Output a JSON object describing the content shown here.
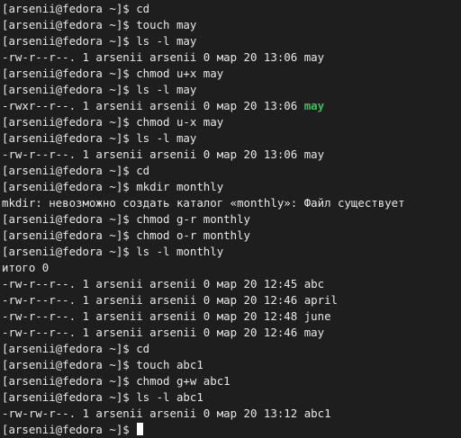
{
  "terminal": {
    "prompt": "[arsenii@fedora ~]$ ",
    "lines": [
      "[arsenii@fedora ~]$ cd",
      "[arsenii@fedora ~]$ touch may",
      "[arsenii@fedora ~]$ ls -l may",
      "-rw-r--r--. 1 arsenii arsenii 0 мар 20 13:06 may",
      "[arsenii@fedora ~]$ chmod u+x may",
      "[arsenii@fedora ~]$ ls -l may",
      "-rwxr--r--. 1 arsenii arsenii 0 мар 20 13:06 ",
      "[arsenii@fedora ~]$ chmod u-x may",
      "[arsenii@fedora ~]$ ls -l may",
      "-rw-r--r--. 1 arsenii arsenii 0 мар 20 13:06 may",
      "[arsenii@fedora ~]$ cd",
      "[arsenii@fedora ~]$ mkdir monthly",
      "mkdir: невозможно создать каталог «monthly»: Файл существует",
      "[arsenii@fedora ~]$ chmod g-r monthly",
      "[arsenii@fedora ~]$ chmod o-r monthly",
      "[arsenii@fedora ~]$ ls -l monthly",
      "итого 0",
      "-rw-r--r--. 1 arsenii arsenii 0 мар 20 12:45 abc",
      "-rw-r--r--. 1 arsenii arsenii 0 мар 20 12:46 april",
      "-rw-r--r--. 1 arsenii arsenii 0 мар 20 12:48 june",
      "-rw-r--r--. 1 arsenii arsenii 0 мар 20 12:46 may",
      "[arsenii@fedora ~]$ cd",
      "[arsenii@fedora ~]$ touch abc1",
      "[arsenii@fedora ~]$ chmod g+w abc1",
      "[arsenii@fedora ~]$ ls -l abc1",
      "-rw-rw-r--. 1 arsenii arsenii 0 мар 20 13:12 abc1"
    ],
    "executable_name": "may",
    "colors": {
      "background": "#1e1e1e",
      "foreground": "#e8e8e8",
      "executable": "#33c653",
      "cursor": "#ffffff"
    }
  }
}
